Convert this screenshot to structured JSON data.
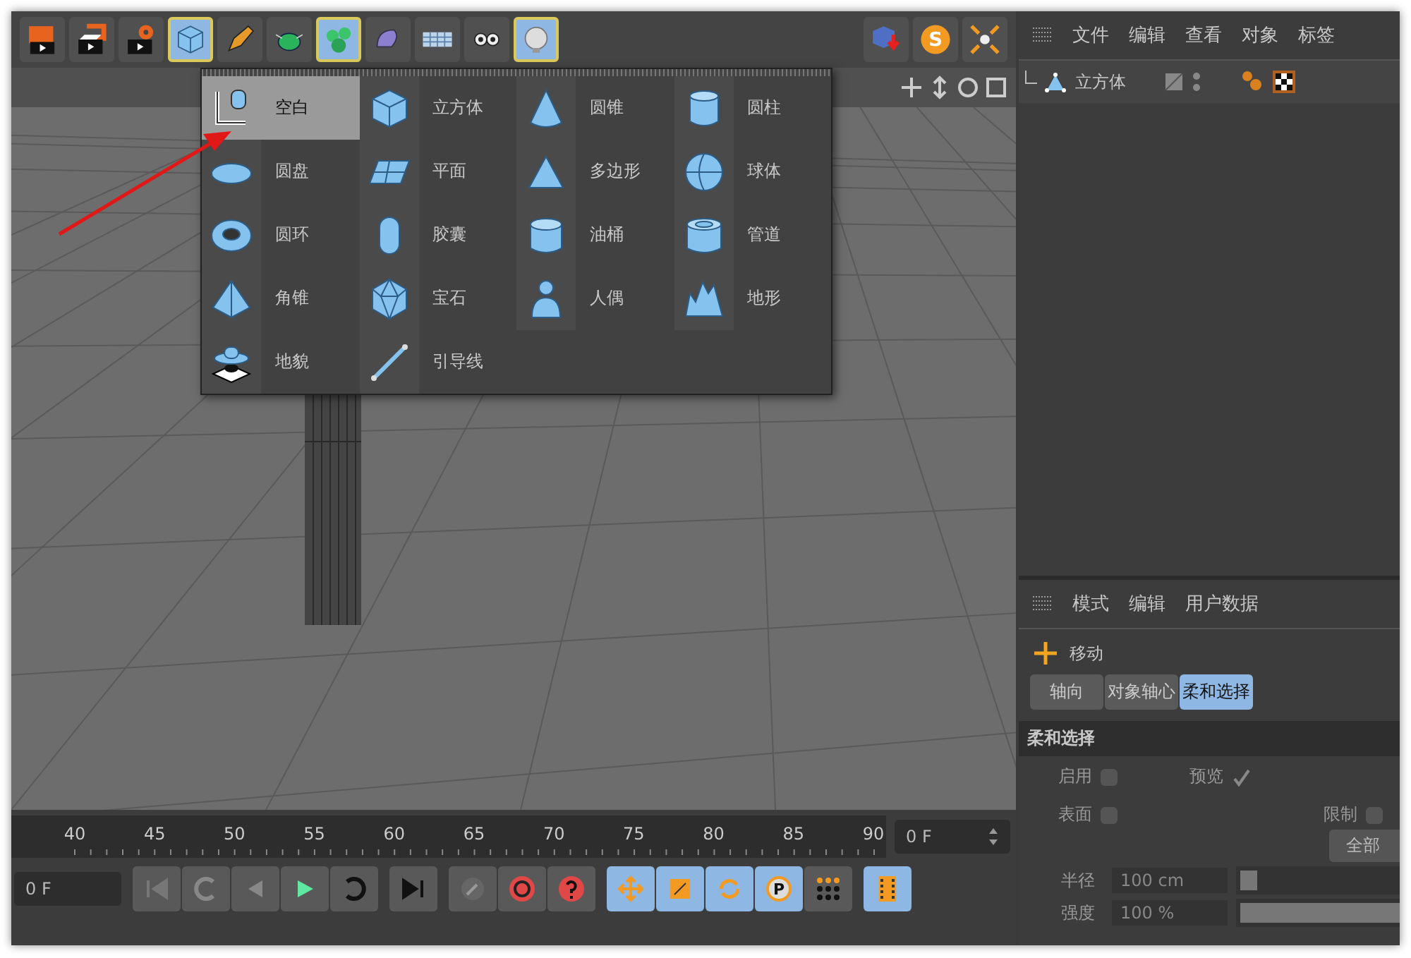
{
  "toolbar": [
    {
      "kind": "render-region",
      "selected": false
    },
    {
      "kind": "render-view",
      "selected": false
    },
    {
      "kind": "render-settings",
      "selected": false
    },
    {
      "kind": "cube",
      "selected": true
    },
    {
      "kind": "pen",
      "selected": false
    },
    {
      "kind": "bug",
      "selected": false
    },
    {
      "kind": "cluster",
      "selected": true
    },
    {
      "kind": "blob",
      "selected": false
    },
    {
      "kind": "grid",
      "selected": false
    },
    {
      "kind": "eyes",
      "selected": false
    },
    {
      "kind": "bulb",
      "selected": true
    }
  ],
  "toolbar_right": [
    {
      "kind": "cube-arrow",
      "selected": false
    },
    {
      "kind": "s-badge",
      "selected": false,
      "glyph": "S"
    },
    {
      "kind": "snap",
      "selected": false
    }
  ],
  "object_menu": {
    "items": [
      {
        "label": "空白",
        "kind": "axis",
        "selected": true
      },
      {
        "label": "立方体",
        "kind": "cube",
        "selected": false
      },
      {
        "label": "圆锥",
        "kind": "cone",
        "selected": false
      },
      {
        "label": "圆柱",
        "kind": "cylinder",
        "selected": false
      },
      {
        "label": "圆盘",
        "kind": "disc",
        "selected": false
      },
      {
        "label": "平面",
        "kind": "plane",
        "selected": false
      },
      {
        "label": "多边形",
        "kind": "triangle",
        "selected": false
      },
      {
        "label": "球体",
        "kind": "sphere",
        "selected": false
      },
      {
        "label": "圆环",
        "kind": "torus",
        "selected": false
      },
      {
        "label": "胶囊",
        "kind": "capsule",
        "selected": false
      },
      {
        "label": "油桶",
        "kind": "drum",
        "selected": false
      },
      {
        "label": "管道",
        "kind": "tube",
        "selected": false
      },
      {
        "label": "角锥",
        "kind": "pyramid",
        "selected": false
      },
      {
        "label": "宝石",
        "kind": "gem",
        "selected": false
      },
      {
        "label": "人偶",
        "kind": "figure",
        "selected": false
      },
      {
        "label": "地形",
        "kind": "landscape",
        "selected": false
      },
      {
        "label": "地貌",
        "kind": "relief",
        "selected": false
      },
      {
        "label": "引导线",
        "kind": "line",
        "selected": false
      }
    ]
  },
  "object_manager": {
    "menu": [
      "文件",
      "编辑",
      "查看",
      "对象",
      "标签"
    ],
    "objects": [
      {
        "name": "立方体"
      }
    ]
  },
  "attribute_manager": {
    "menu": [
      "模式",
      "编辑",
      "用户数据"
    ],
    "tool": "移动",
    "tabs": [
      {
        "label": "轴向",
        "selected": false
      },
      {
        "label": "对象轴心",
        "selected": false
      },
      {
        "label": "柔和选择",
        "selected": true
      }
    ],
    "section": "柔和选择",
    "options": [
      {
        "label": "启用",
        "checked": false
      },
      {
        "label": "预览",
        "checked": true
      },
      {
        "label": "表面",
        "checked": false
      },
      {
        "label": "限制",
        "checked": false
      }
    ],
    "dropdown": "全部",
    "fields": [
      {
        "label": "半径",
        "value": "100 cm",
        "level": 0.1
      },
      {
        "label": "强度",
        "value": "100 %",
        "level": 1
      }
    ]
  },
  "timeline": {
    "ticks": [
      "40",
      "45",
      "50",
      "55",
      "60",
      "65",
      "70",
      "75",
      "80",
      "85",
      "90"
    ],
    "end_frame": "0 F",
    "start_frame": "0 F",
    "modes": [
      {
        "kind": "move",
        "selected": true
      },
      {
        "kind": "scale",
        "selected": true
      },
      {
        "kind": "rotate",
        "selected": true
      },
      {
        "kind": "param",
        "selected": true,
        "glyph": "P"
      },
      {
        "kind": "dots",
        "selected": false
      }
    ]
  }
}
